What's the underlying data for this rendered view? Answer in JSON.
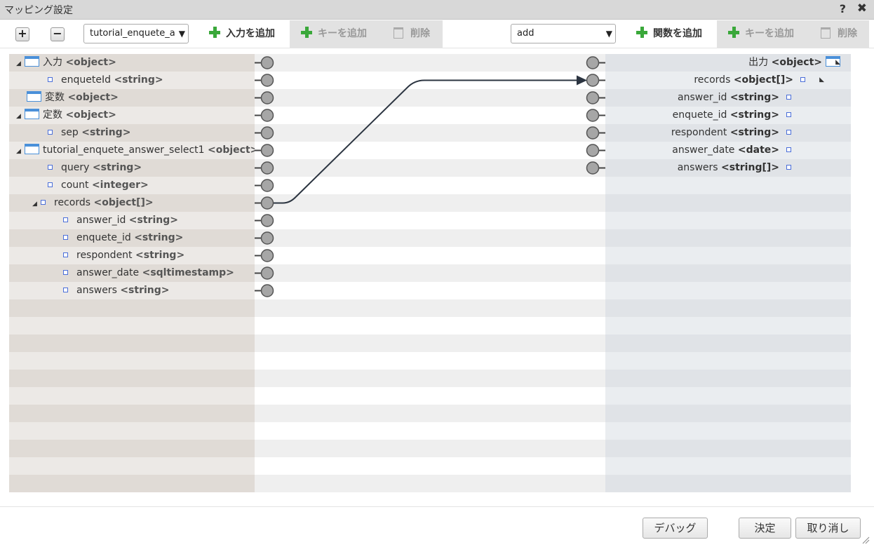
{
  "window": {
    "title": "マッピング設定",
    "help": "?",
    "close": "✖"
  },
  "toolbar": {
    "expand": "+",
    "collapse": "−",
    "input_select": "tutorial_enquete_a",
    "add_input": "入力を追加",
    "add_key_left": "キーを追加",
    "delete_left": "削除",
    "function_select": "add",
    "add_function": "関数を追加",
    "add_key_right": "キーを追加",
    "delete_right": "削除"
  },
  "input_tree": [
    {
      "name": "入力",
      "type": "<object>",
      "icon": "object-icon",
      "expander": "◢"
    },
    {
      "name": "enqueteId",
      "type": "<string>",
      "icon": "leaf-icon"
    },
    {
      "name": "変数",
      "type": "<object>",
      "icon": "object-icon"
    },
    {
      "name": "定数",
      "type": "<object>",
      "icon": "object-icon",
      "expander": "◢"
    },
    {
      "name": "sep",
      "type": "<string>",
      "icon": "leaf-icon"
    },
    {
      "name": "tutorial_enquete_answer_select1",
      "type": "<object>",
      "icon": "object-icon",
      "expander": "◢"
    },
    {
      "name": "query",
      "type": "<string>",
      "icon": "leaf-icon"
    },
    {
      "name": "count",
      "type": "<integer>",
      "icon": "leaf-icon"
    },
    {
      "name": "records",
      "type": "<object[]>",
      "icon": "leaf-icon",
      "expander": "◢"
    },
    {
      "name": "answer_id",
      "type": "<string>",
      "icon": "leaf-icon"
    },
    {
      "name": "enquete_id",
      "type": "<string>",
      "icon": "leaf-icon"
    },
    {
      "name": "respondent",
      "type": "<string>",
      "icon": "leaf-icon"
    },
    {
      "name": "answer_date",
      "type": "<sqltimestamp>",
      "icon": "leaf-icon"
    },
    {
      "name": "answers",
      "type": "<string>",
      "icon": "leaf-icon"
    }
  ],
  "output_tree": [
    {
      "name": "出力",
      "type": "<object>",
      "icon": "object-icon",
      "expander": "◣"
    },
    {
      "name": "records",
      "type": "<object[]>",
      "icon": "leaf-icon",
      "expander": "◣"
    },
    {
      "name": "answer_id",
      "type": "<string>",
      "icon": "leaf-icon"
    },
    {
      "name": "enquete_id",
      "type": "<string>",
      "icon": "leaf-icon"
    },
    {
      "name": "respondent",
      "type": "<string>",
      "icon": "leaf-icon"
    },
    {
      "name": "answer_date",
      "type": "<date>",
      "icon": "leaf-icon"
    },
    {
      "name": "answers",
      "type": "<string[]>",
      "icon": "leaf-icon"
    }
  ],
  "connections": [
    {
      "from": "tutorial_enquete_answer_select1.records",
      "to": "出力.records"
    }
  ],
  "footer": {
    "debug": "デバッグ",
    "ok": "決定",
    "cancel": "取り消し"
  },
  "colors": {
    "plus_green": "#3aa83a",
    "object_icon_blue": "#4a90d9",
    "wire": "#2b3440"
  }
}
